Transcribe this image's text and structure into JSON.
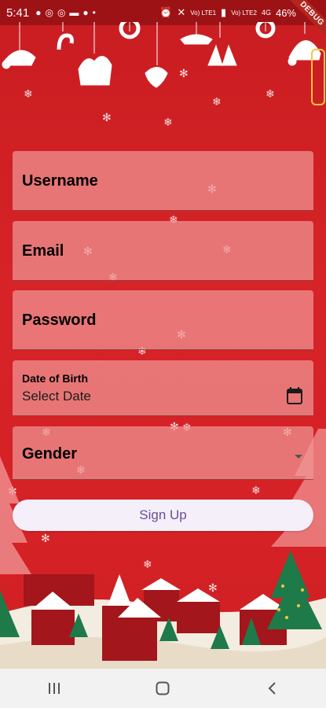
{
  "status_bar": {
    "time": "5:41",
    "network_1": "Vo) LTE1",
    "network_2": "Vo) LTE2",
    "network_type": "4G",
    "battery": "46%"
  },
  "debug_banner": "DEBUG",
  "form": {
    "username_label": "Username",
    "email_label": "Email",
    "password_label": "Password",
    "dob_label": "Date of Birth",
    "dob_value": "Select Date",
    "gender_label": "Gender"
  },
  "signup_label": "Sign Up",
  "icons": {
    "calendar": "calendar-icon",
    "dropdown": "dropdown-arrow-icon",
    "nav_recents": "recents-icon",
    "nav_home": "home-icon",
    "nav_back": "back-icon"
  },
  "colors": {
    "background": "#d01f24",
    "field": "#f09696",
    "button_bg": "#f4eff8",
    "button_text": "#6a4f9c"
  }
}
